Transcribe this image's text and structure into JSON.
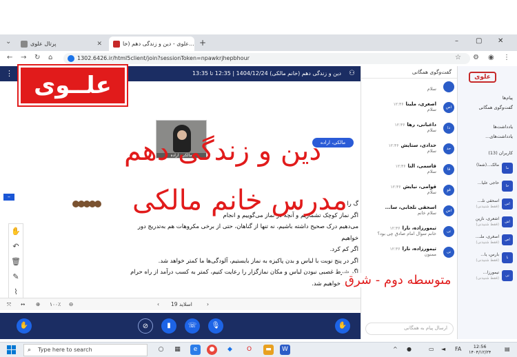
{
  "browser": {
    "tabs": [
      {
        "title": "پرتال علوی"
      },
      {
        "title": "علوی - دین و زندگی دهم (خا..."
      }
    ],
    "new_tab": "+",
    "address": "1302.6426.ir/html5client/join?sessionToken=npawkrjhepbhour",
    "window_controls": {
      "minimize": "–",
      "maximize": "▢",
      "close": "✕"
    }
  },
  "meeting": {
    "title": "دین و زندگی دهم (خانم مالکی) 1404/12/24 | 12:35 تا 13:35",
    "presenter_badge": "مالکی، اراده",
    "video_label": "مالکی، اراده"
  },
  "document_lines": [
    "گ  را",
    "اگر نماز کوچک تشماریم و  آنچه در نماز می‌گوییم و انجام",
    "می‌دهیم درک صحیح داشته باشیم، نه تنها از گناهان، حتی از برخی مکروهات هم به‌تدریج دور",
    "خواهیم",
    "اگر                                                              کم کرد.",
    "اگر در پنج نوبت با لباس و بدن پاکیزه به نماز بایستیم، آلودگی‌ها ما کمتر خواهد شد.",
    "اگر شرط غصبی نبودن لباس و مکان نمازگزار را رعایت کنیم، کمتر به کسب درآمد از راه حرام",
    "متمایل خواهیم شد."
  ],
  "pager": {
    "slide_label": "اسلاید 19",
    "zoom": "۱۰۰٪"
  },
  "chat": {
    "header": "گفت‌وگوی همگانی",
    "messages": [
      {
        "initials": "",
        "name": "",
        "time": "",
        "text": "سلام"
      },
      {
        "initials": "اص",
        "name": "اصغری، ملینا",
        "time": "۱۲:۳۶",
        "text": "سلام"
      },
      {
        "initials": "دا",
        "name": "داغبانی، رها",
        "time": "۱۲:۳۶",
        "text": "سلام"
      },
      {
        "initials": "حد",
        "name": "حدادی، ستایش",
        "time": "۱۲:۳۶",
        "text": "سلام"
      },
      {
        "initials": "قا",
        "name": "قاسمی، النا",
        "time": "۱۲:۳۶",
        "text": "سلام"
      },
      {
        "initials": "قو",
        "name": "قوامی، نیایش",
        "time": "۱۲:۳۶",
        "text": "سلام"
      },
      {
        "initials": "اس",
        "name": "اسحقی نلجابی، سا...",
        "time": "",
        "text": "سلام خانم"
      },
      {
        "initials": "تی",
        "name": "تیمورزاده، نارا",
        "time": "۱۲:۳۶",
        "text": "خانم سوال امام صادق چی بود؟"
      },
      {
        "initials": "تی",
        "name": "تیمورزاده، نارا",
        "time": "۱۲:۳۶",
        "text": "ممنون"
      }
    ],
    "input_placeholder": "ارسال پیام به همگانی"
  },
  "sidebar": {
    "logo": "علوی",
    "messages_section": "پیام‌ها",
    "public_chat": "گفت‌وگوی همگانی",
    "notes_section": "یادداشت‌ها",
    "shared_notes": "یادداشت‌های...",
    "users_section": "کاربران (13)",
    "users": [
      {
        "initials": "ما",
        "name": "مالک...(شما)",
        "status": ""
      },
      {
        "initials": "حا",
        "name": "حاجی علیا...",
        "status": ""
      },
      {
        "initials": "اس",
        "name": "اسحقی نلـ...",
        "status": "(فقط شنیدنی)"
      },
      {
        "initials": "اش",
        "name": "اشعری، نازین",
        "status": "(فقط شنیدنی)"
      },
      {
        "initials": "اص",
        "name": "اصغری، ملـ...",
        "status": "(فقط شنیدنی)"
      },
      {
        "initials": "با",
        "name": "بارس، یا...",
        "status": "(فقط شنیدنی)"
      },
      {
        "initials": "تی",
        "name": "تیمورزا...",
        "status": "(فقط شنیدنی)"
      }
    ]
  },
  "overlay": {
    "brand": "علــوی",
    "title_line1": "دین و زندگی دهم",
    "title_line2": "مدرس خانم مالکی",
    "subtitle": "متوسطه دوم - شرق"
  },
  "taskbar": {
    "search_placeholder": "Type here to search",
    "time": "12:56",
    "lang": "FA",
    "date": "۱۴۰۴/۱۲/۲۴"
  },
  "colors": {
    "accent_red": "#e11b1b",
    "meeting_navy": "#1b2d63",
    "action_blue": "#1d64e6"
  }
}
